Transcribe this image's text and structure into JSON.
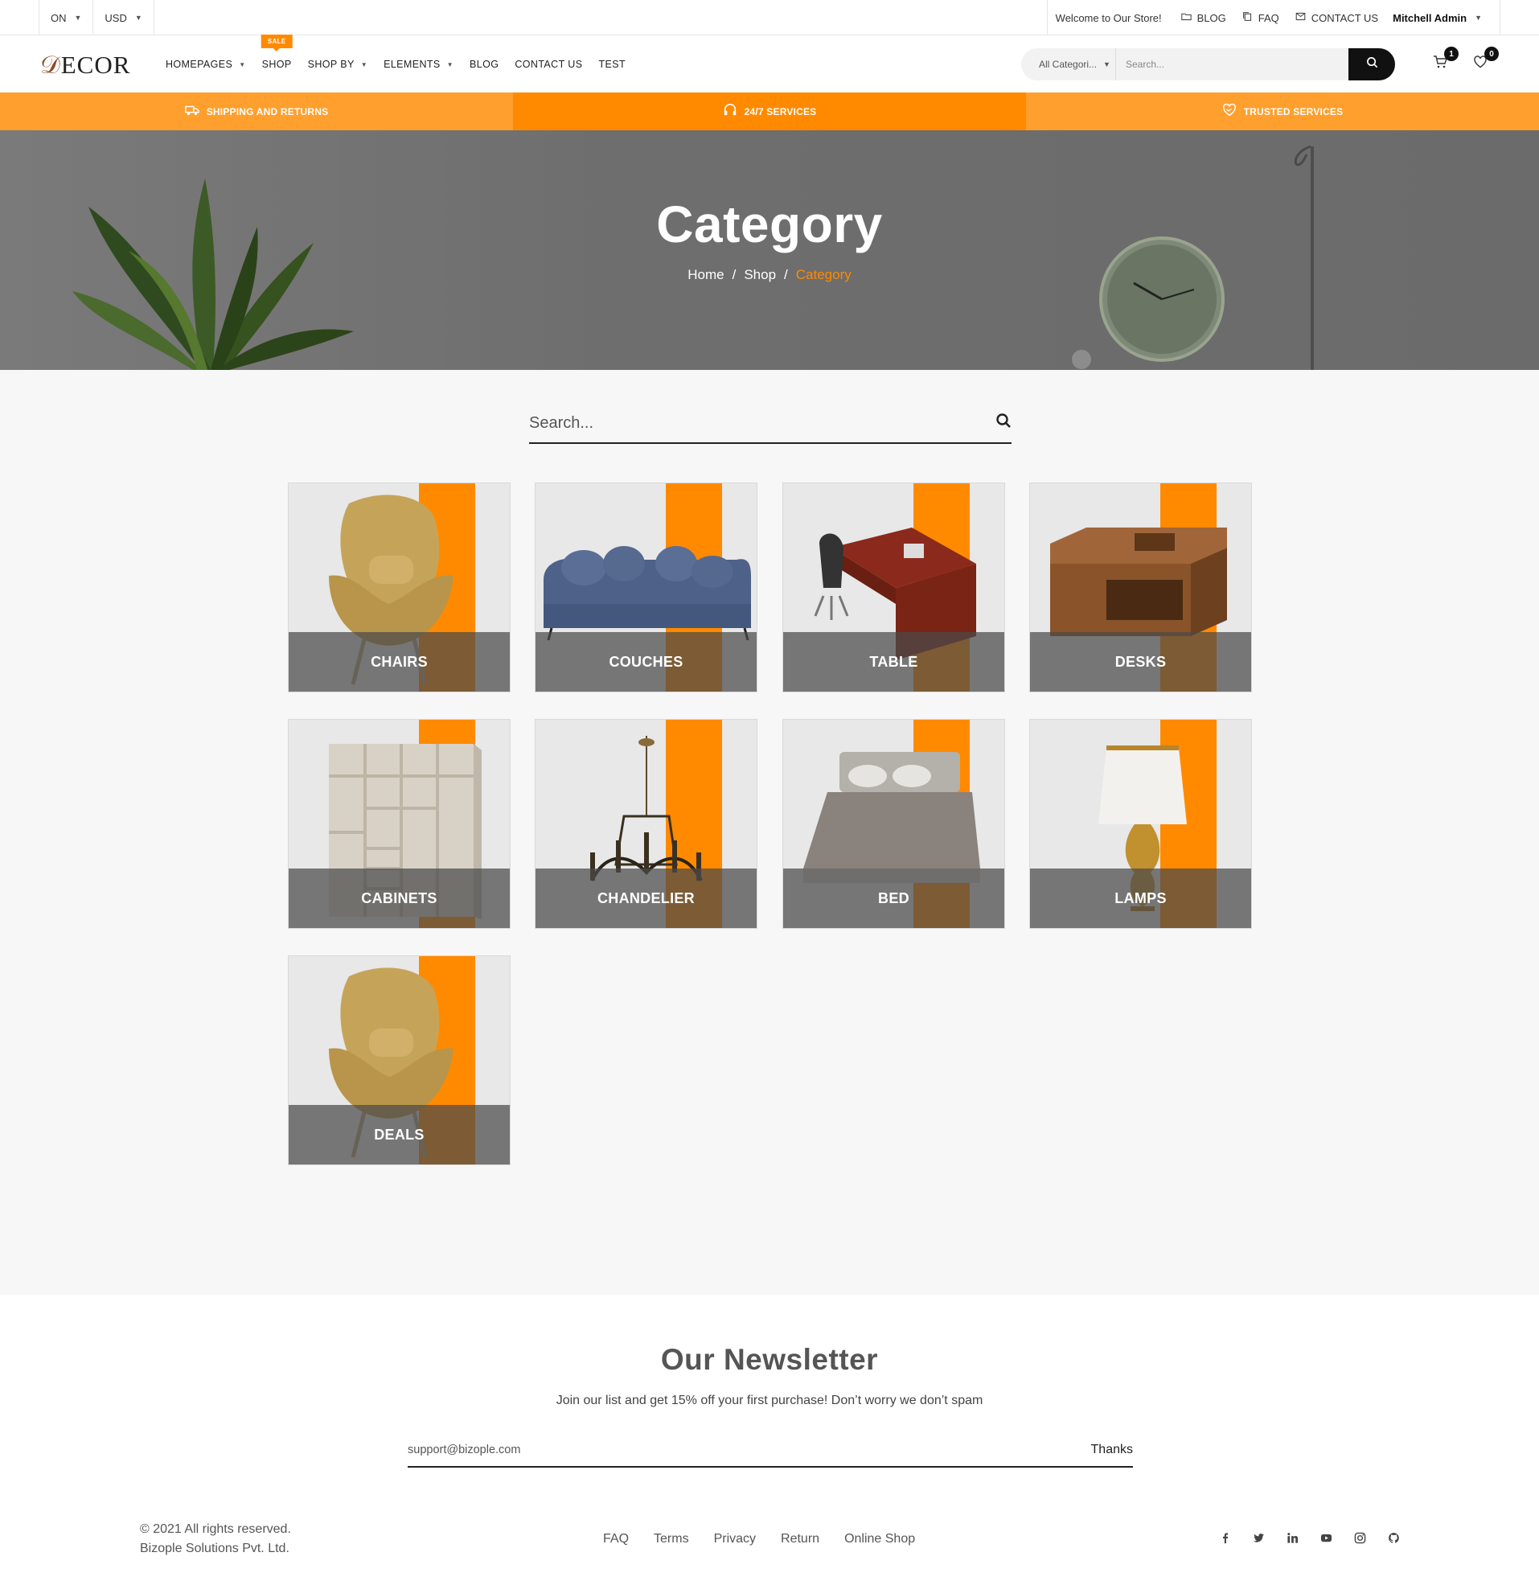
{
  "topbar": {
    "language": "ON",
    "currency": "USD",
    "welcome": "Welcome to Our Store!",
    "links": [
      {
        "label": "BLOG",
        "icon": "folder-icon"
      },
      {
        "label": "FAQ",
        "icon": "copy-icon"
      },
      {
        "label": "CONTACT US",
        "icon": "mail-icon"
      }
    ],
    "user": "Mitchell Admin"
  },
  "header": {
    "logo": "DECOR",
    "nav": [
      {
        "label": "HOMEPAGES",
        "dropdown": true
      },
      {
        "label": "SHOP",
        "badge": "SALE"
      },
      {
        "label": "SHOP BY",
        "dropdown": true
      },
      {
        "label": "ELEMENTS",
        "dropdown": true
      },
      {
        "label": "BLOG"
      },
      {
        "label": "CONTACT US"
      },
      {
        "label": "TEST"
      }
    ],
    "search_category": "All Categori...",
    "search_placeholder": "Search...",
    "cart_count": "1",
    "wishlist_count": "0"
  },
  "services": [
    {
      "label": "SHIPPING AND RETURNS",
      "icon": "truck-icon",
      "color": "#ff9f2e"
    },
    {
      "label": "24/7 SERVICES",
      "icon": "headphones-icon",
      "color": "#ff8a00"
    },
    {
      "label": "TRUSTED SERVICES",
      "icon": "handshake-heart-icon",
      "color": "#ff9f2e"
    }
  ],
  "hero": {
    "title": "Category",
    "breadcrumb": [
      "Home",
      "Shop",
      "Category"
    ]
  },
  "category_search": {
    "placeholder": "Search..."
  },
  "categories": [
    {
      "label": "CHAIRS",
      "image": "armchair"
    },
    {
      "label": "COUCHES",
      "image": "sofa"
    },
    {
      "label": "TABLE",
      "image": "office-desk"
    },
    {
      "label": "DESKS",
      "image": "wooden-box-table"
    },
    {
      "label": "CABINETS",
      "image": "wardrobe"
    },
    {
      "label": "CHANDELIER",
      "image": "chandelier"
    },
    {
      "label": "BED",
      "image": "bed"
    },
    {
      "label": "LAMPS",
      "image": "table-lamp"
    },
    {
      "label": "DEALS",
      "image": "armchair"
    }
  ],
  "newsletter": {
    "title": "Our Newsletter",
    "subtitle": "Join our list and get 15% off your first purchase! Don’t worry we don’t spam",
    "email": "support@bizople.com",
    "button": "Thanks"
  },
  "footer": {
    "copyright_line1": "© 2021 All rights reserved.",
    "copyright_line2": "Bizople Solutions Pvt. Ltd.",
    "links": [
      "FAQ",
      "Terms",
      "Privacy",
      "Return",
      "Online Shop"
    ],
    "social": [
      "facebook-icon",
      "twitter-icon",
      "linkedin-icon",
      "youtube-icon",
      "instagram-icon",
      "github-icon"
    ]
  },
  "colors": {
    "accent": "#ff8a00",
    "accent_light": "#ff9f2e",
    "dark": "#111111"
  }
}
